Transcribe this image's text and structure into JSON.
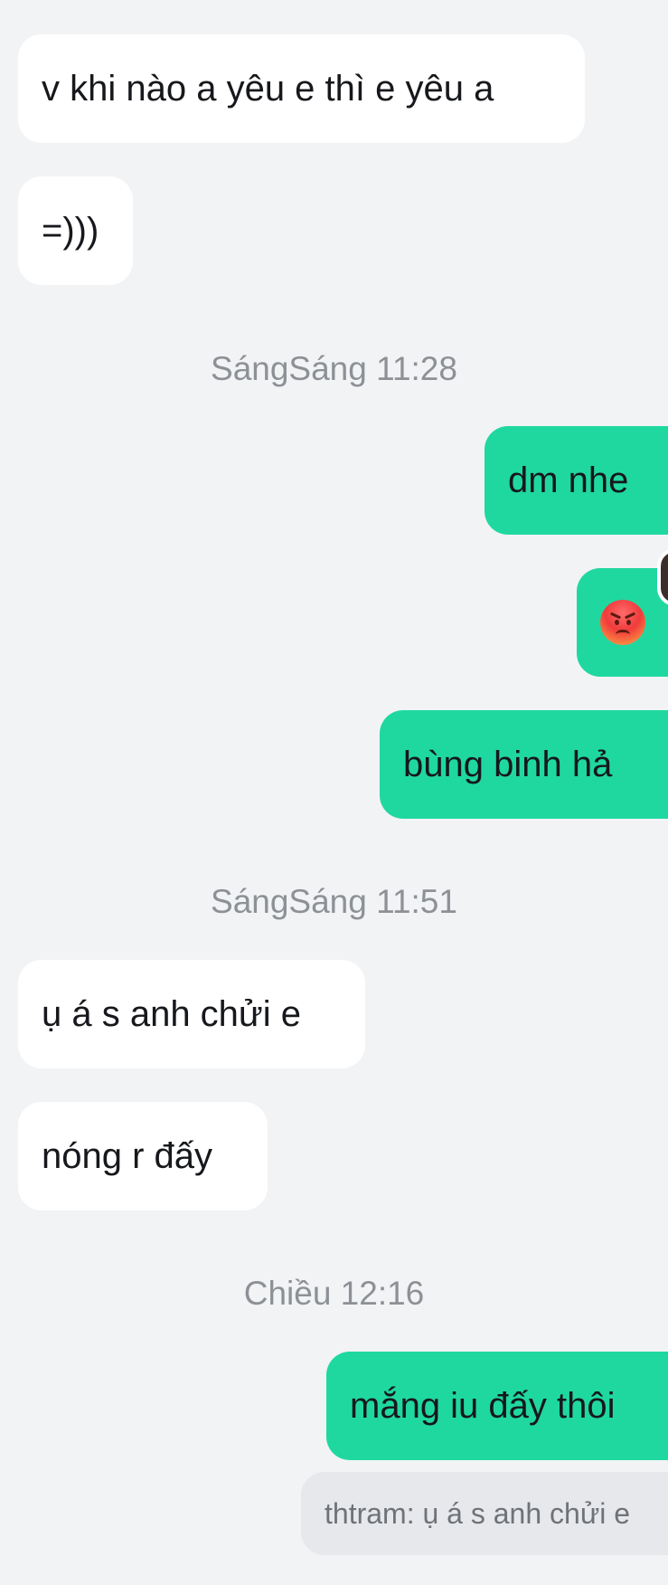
{
  "messages": [
    {
      "text": "v khi nào a yêu e thì e yêu a"
    },
    {
      "text": "=)))"
    },
    {
      "text": "dm nhe"
    },
    {
      "emoji": "angry-face"
    },
    {
      "text": "bùng binh hả"
    },
    {
      "text": "ụ á s anh chửi e"
    },
    {
      "text": "nóng r đấy"
    },
    {
      "text": "mắng iu đấy thôi"
    }
  ],
  "timestamps": [
    {
      "text": "SángSáng 11:28"
    },
    {
      "text": "SángSáng 11:51"
    },
    {
      "text": "Chiều 12:16"
    }
  ],
  "reply_quote": {
    "text": "thtram: ụ á s anh chửi e"
  },
  "colors": {
    "background": "#f2f3f5",
    "incoming_bubble": "#ffffff",
    "outgoing_bubble": "#1fd8a0",
    "timestamp_text": "#8d9196"
  }
}
